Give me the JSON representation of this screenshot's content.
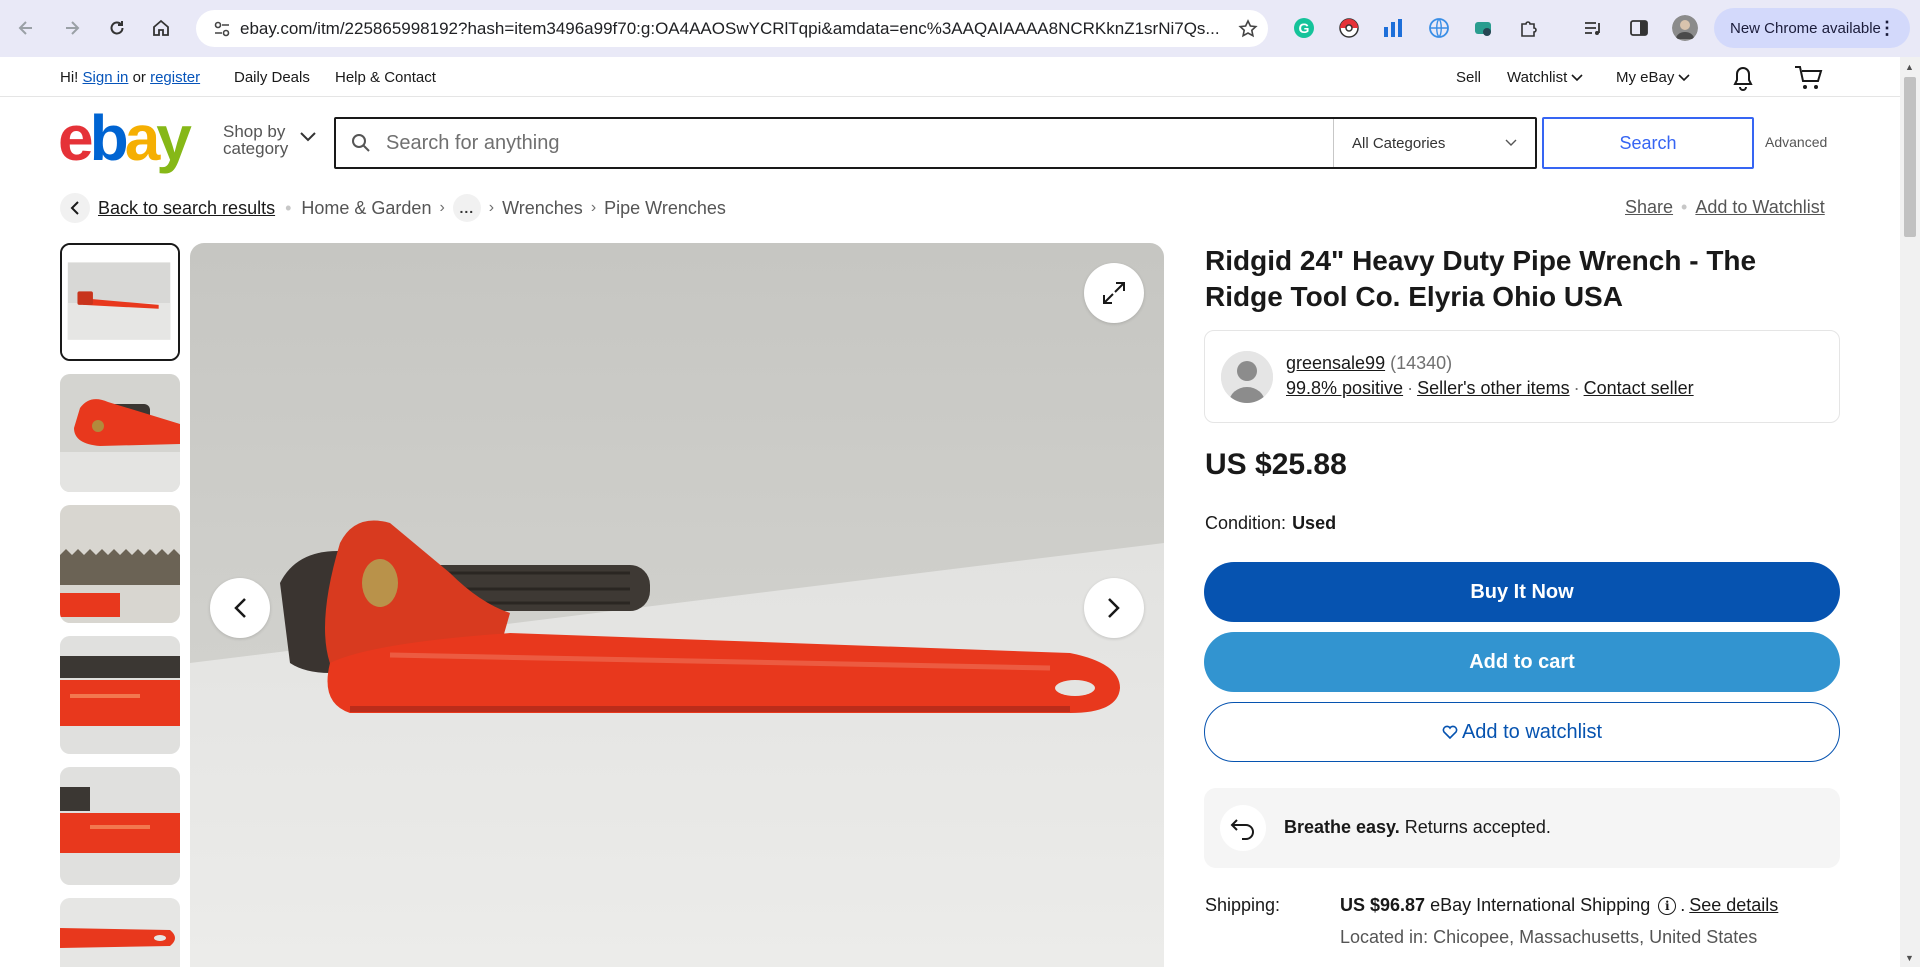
{
  "browser": {
    "url": "ebay.com/itm/225865998192?hash=item3496a99f70:g:OA4AAOSwYCRlTqpi&amdata=enc%3AAQAIAAAA8NCRKknZ1srNi7Qs...",
    "update_label": "New Chrome available",
    "extensions": [
      "grammarly-icon",
      "pokeball-icon",
      "chart-icon",
      "globe-icon",
      "puzzle-icon"
    ]
  },
  "toplinks": {
    "greeting": "Hi!",
    "sign_in": "Sign in",
    "or": "or",
    "register": "register",
    "daily_deals": "Daily Deals",
    "help": "Help & Contact",
    "sell": "Sell",
    "watchlist": "Watchlist",
    "my_ebay": "My eBay"
  },
  "header": {
    "shop_by_line1": "Shop by",
    "shop_by_line2": "category",
    "search_placeholder": "Search for anything",
    "category": "All Categories",
    "search_button": "Search",
    "advanced": "Advanced",
    "logo_colors": [
      "#e53238",
      "#0064d2",
      "#f5af02",
      "#86b817"
    ]
  },
  "breadcrumb": {
    "back": "Back to search results",
    "items": [
      "Home & Garden",
      "Wrenches",
      "Pipe Wrenches"
    ],
    "ellipsis": "...",
    "share": "Share",
    "add_to_watchlist": "Add to Watchlist"
  },
  "gallery": {
    "thumbnail_count": 6,
    "active_index": 0
  },
  "listing": {
    "title": "Ridgid 24\" Heavy Duty Pipe Wrench - The Ridge Tool Co. Elyria Ohio USA",
    "seller_name": "greensale99",
    "seller_feedback": "(14340)",
    "positive": "99.8% positive",
    "other_items": "Seller's other items",
    "contact": "Contact seller",
    "price": "US $25.88",
    "condition_label": "Condition:",
    "condition_value": "Used",
    "buy_now": "Buy It Now",
    "add_to_cart": "Add to cart",
    "add_to_watchlist": "Add to watchlist",
    "returns_bold": "Breathe easy.",
    "returns_text": "Returns accepted.",
    "shipping_label": "Shipping:",
    "shipping_price": "US $96.87",
    "shipping_service": "eBay International Shipping",
    "shipping_details": "See details",
    "location": "Located in: Chicopee, Massachusetts, United States"
  },
  "colors": {
    "buy_now": "#0653b0",
    "add_to_cart": "#3294d0",
    "wrench": "#e8381d"
  }
}
